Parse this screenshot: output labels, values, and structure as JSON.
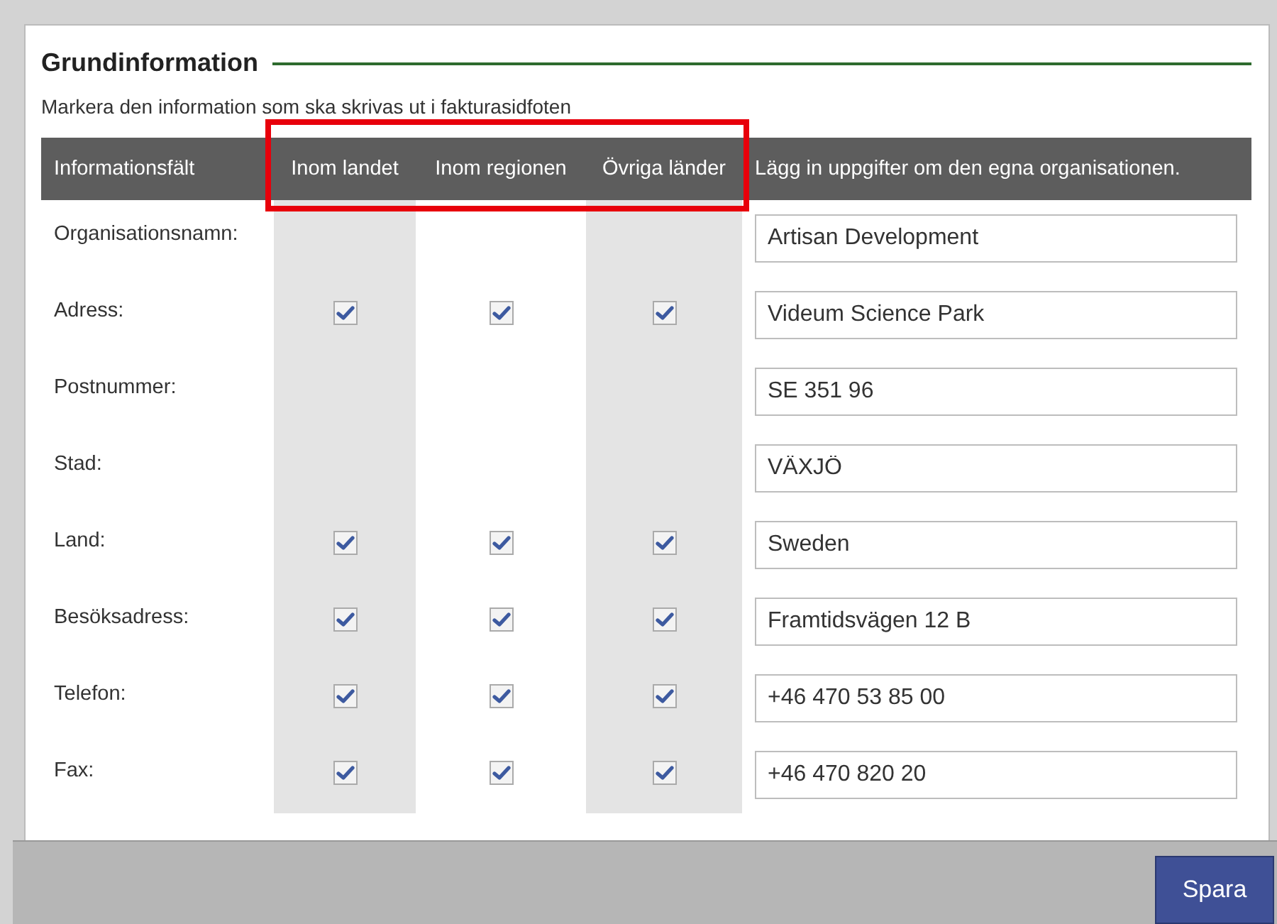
{
  "section": {
    "title": "Grundinformation",
    "instruction": "Markera den information som ska skrivas ut i fakturasidfoten"
  },
  "columns": [
    {
      "label": "Informationsfält",
      "highlighted": false
    },
    {
      "label": "Inom landet",
      "highlighted": true
    },
    {
      "label": "Inom regionen",
      "highlighted": true
    },
    {
      "label": "Övriga länder",
      "highlighted": true
    },
    {
      "label": "Lägg in uppgifter om den egna organisationen.",
      "highlighted": false
    }
  ],
  "rows": [
    {
      "label": "Organisationsnamn:",
      "kind": "fixed",
      "value": "Artisan Development"
    },
    {
      "label": "Adress:",
      "kind": "selectable",
      "checks": [
        true,
        true,
        true
      ],
      "value": "Videum Science Park"
    },
    {
      "label": "Postnummer:",
      "kind": "fixed",
      "value": "SE 351 96"
    },
    {
      "label": "Stad:",
      "kind": "fixed",
      "value": "VÄXJÖ"
    },
    {
      "label": "Land:",
      "kind": "selectable",
      "checks": [
        true,
        true,
        true
      ],
      "value": "Sweden"
    },
    {
      "label": "Besöksadress:",
      "kind": "selectable",
      "checks": [
        true,
        true,
        true
      ],
      "value": "Framtidsvägen 12 B"
    },
    {
      "label": "Telefon:",
      "kind": "selectable",
      "checks": [
        true,
        true,
        true
      ],
      "value": "+46 470 53 85 00"
    },
    {
      "label": "Fax:",
      "kind": "selectable",
      "checks": [
        true,
        true,
        true
      ],
      "value": "+46 470 820 20"
    }
  ],
  "footer": {
    "save_button": "Spara"
  }
}
